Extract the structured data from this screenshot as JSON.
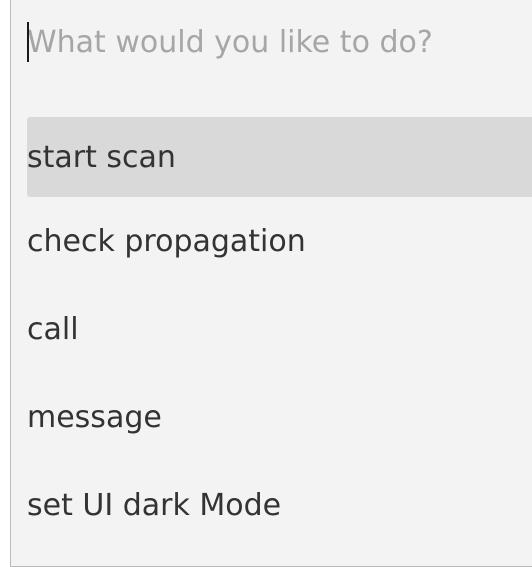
{
  "command_palette": {
    "search": {
      "placeholder": "What would you like to do?",
      "value": ""
    },
    "items": [
      {
        "label": "start scan",
        "selected": true
      },
      {
        "label": "check propagation",
        "selected": false
      },
      {
        "label": "call",
        "selected": false
      },
      {
        "label": "message",
        "selected": false
      },
      {
        "label": "set UI dark Mode",
        "selected": false
      }
    ],
    "colors": {
      "panel_background": "#f3f3f3",
      "selected_background": "#d9d9d9",
      "placeholder_text": "#a6a6a6",
      "item_text": "#333333",
      "border": "#b9b9b9"
    }
  }
}
